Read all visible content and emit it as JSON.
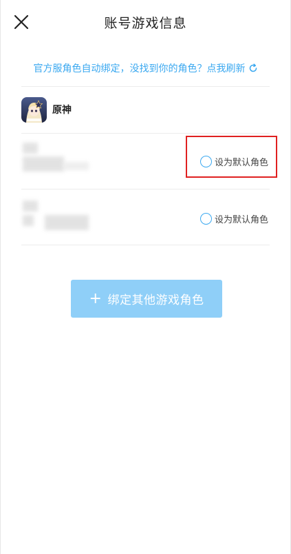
{
  "header": {
    "title": "账号游戏信息",
    "close_icon": "close-icon"
  },
  "hint": {
    "text": "官方服角色自动绑定，没找到你的角色？点我刷新",
    "color": "#3aa8f0",
    "icon": "refresh-icon"
  },
  "game": {
    "name": "原神",
    "logo_icon": "genshin-app-icon"
  },
  "roles": [
    {
      "default_label": "设为默认角色",
      "selected": false
    },
    {
      "default_label": "设为默认角色",
      "selected": false
    }
  ],
  "bind_button": {
    "plus": "+",
    "label": "绑定其他游戏角色",
    "color": "#8fcff8"
  }
}
